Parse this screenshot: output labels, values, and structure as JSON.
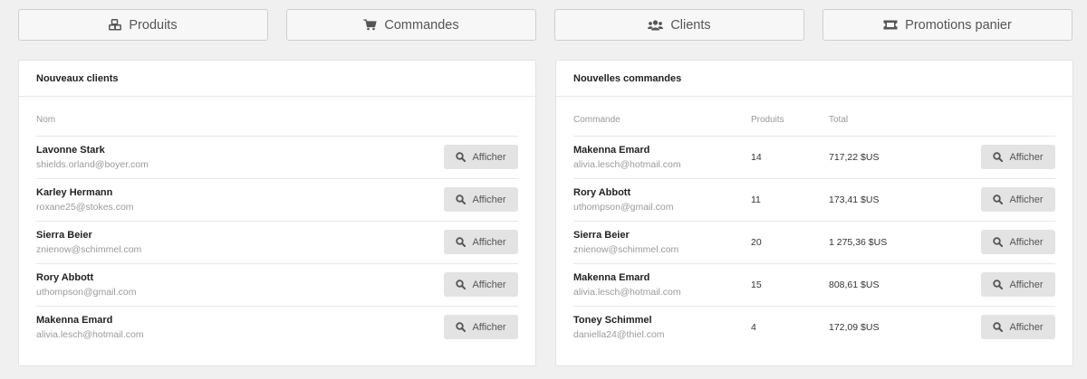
{
  "nav": [
    {
      "label": "Produits",
      "icon": "cubes-icon"
    },
    {
      "label": "Commandes",
      "icon": "cart-icon"
    },
    {
      "label": "Clients",
      "icon": "users-icon"
    },
    {
      "label": "Promotions panier",
      "icon": "ticket-icon"
    }
  ],
  "customers": {
    "title": "Nouveaux clients",
    "col_name": "Nom",
    "button_label": "Afficher",
    "rows": [
      {
        "name": "Lavonne Stark",
        "email": "shields.orland@boyer.com"
      },
      {
        "name": "Karley Hermann",
        "email": "roxane25@stokes.com"
      },
      {
        "name": "Sierra Beier",
        "email": "znienow@schimmel.com"
      },
      {
        "name": "Rory Abbott",
        "email": "uthompson@gmail.com"
      },
      {
        "name": "Makenna Emard",
        "email": "alivia.lesch@hotmail.com"
      }
    ]
  },
  "orders": {
    "title": "Nouvelles commandes",
    "col_order": "Commande",
    "col_products": "Produits",
    "col_total": "Total",
    "button_label": "Afficher",
    "rows": [
      {
        "name": "Makenna Emard",
        "email": "alivia.lesch@hotmail.com",
        "products": "14",
        "total": "717,22 $US"
      },
      {
        "name": "Rory Abbott",
        "email": "uthompson@gmail.com",
        "products": "11",
        "total": "173,41 $US"
      },
      {
        "name": "Sierra Beier",
        "email": "znienow@schimmel.com",
        "products": "20",
        "total": "1 275,36 $US"
      },
      {
        "name": "Makenna Emard",
        "email": "alivia.lesch@hotmail.com",
        "products": "15",
        "total": "808,61 $US"
      },
      {
        "name": "Toney Schimmel",
        "email": "daniella24@thiel.com",
        "products": "4",
        "total": "172,09 $US"
      }
    ]
  }
}
